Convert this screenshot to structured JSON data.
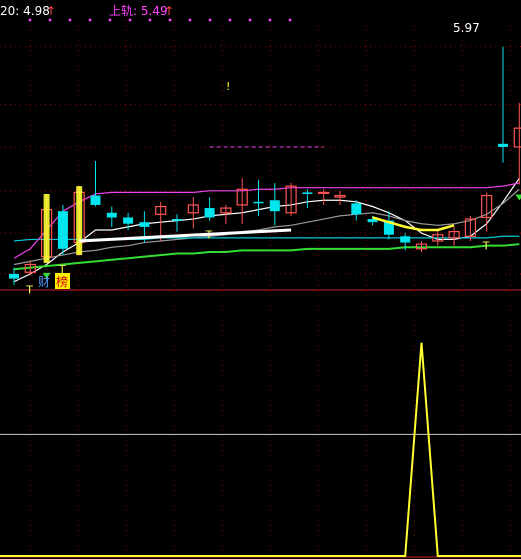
{
  "header": {
    "ma_label": "20: 4.98",
    "ma_arrow": "↑",
    "upper_label": "上轨: 5.49",
    "upper_arrow": "↑"
  },
  "annotations": {
    "high_price": "5.97",
    "t_marker": "T",
    "excl_marker": "!",
    "tag_cai": "财",
    "tag_bang": "榜"
  },
  "colors": {
    "up": "#ff5555",
    "down": "#00e5ee",
    "ma_white": "#ffffff",
    "ma_gray": "#999999",
    "mid_cyan": "#00c8d8",
    "lower_green": "#33dd33",
    "upper_magenta": "#ee44ee",
    "signal_yellow": "#ffff33",
    "ma_label": "#ffffff",
    "upper_label": "#ff44ff",
    "grid": "#880000"
  },
  "chart_data": [
    {
      "type": "candlestick",
      "price_range": [
        4.43,
        6.14
      ],
      "candles": [
        {
          "open": 4.52,
          "high": 4.56,
          "low": 4.45,
          "close": 4.49
        },
        {
          "open": 4.53,
          "high": 4.6,
          "low": 4.51,
          "close": 4.58
        },
        {
          "open": 4.63,
          "high": 5.03,
          "low": 4.59,
          "close": 4.93
        },
        {
          "open": 4.92,
          "high": 4.96,
          "low": 4.64,
          "close": 4.68
        },
        {
          "open": 4.72,
          "high": 5.08,
          "low": 4.64,
          "close": 5.04
        },
        {
          "open": 5.02,
          "high": 5.24,
          "low": 4.95,
          "close": 4.96
        },
        {
          "open": 4.91,
          "high": 4.95,
          "low": 4.82,
          "close": 4.88
        },
        {
          "open": 4.88,
          "high": 4.91,
          "low": 4.8,
          "close": 4.84
        },
        {
          "open": 4.85,
          "high": 4.92,
          "low": 4.72,
          "close": 4.82
        },
        {
          "open": 4.9,
          "high": 4.98,
          "low": 4.73,
          "close": 4.95
        },
        {
          "open": 4.87,
          "high": 4.9,
          "low": 4.79,
          "close": 4.86
        },
        {
          "open": 4.91,
          "high": 5.01,
          "low": 4.81,
          "close": 4.96
        },
        {
          "open": 4.94,
          "high": 5.01,
          "low": 4.86,
          "close": 4.88
        },
        {
          "open": 4.91,
          "high": 4.96,
          "low": 4.84,
          "close": 4.94
        },
        {
          "open": 4.96,
          "high": 5.13,
          "low": 4.84,
          "close": 5.06
        },
        {
          "open": 4.98,
          "high": 5.12,
          "low": 4.89,
          "close": 4.97
        },
        {
          "open": 4.99,
          "high": 5.1,
          "low": 4.83,
          "close": 4.92
        },
        {
          "open": 4.91,
          "high": 5.1,
          "low": 4.89,
          "close": 5.08
        },
        {
          "open": 5.04,
          "high": 5.06,
          "low": 4.94,
          "close": 5.03
        },
        {
          "open": 5.04,
          "high": 5.06,
          "low": 4.96,
          "close": 5.04
        },
        {
          "open": 5.01,
          "high": 5.05,
          "low": 4.96,
          "close": 5.02
        },
        {
          "open": 4.97,
          "high": 4.99,
          "low": 4.86,
          "close": 4.9
        },
        {
          "open": 4.87,
          "high": 4.89,
          "low": 4.83,
          "close": 4.85
        },
        {
          "open": 4.86,
          "high": 4.92,
          "low": 4.74,
          "close": 4.77
        },
        {
          "open": 4.76,
          "high": 4.78,
          "low": 4.67,
          "close": 4.72
        },
        {
          "open": 4.68,
          "high": 4.73,
          "low": 4.66,
          "close": 4.71
        },
        {
          "open": 4.73,
          "high": 4.81,
          "low": 4.7,
          "close": 4.77
        },
        {
          "open": 4.75,
          "high": 4.82,
          "low": 4.7,
          "close": 4.79
        },
        {
          "open": 4.76,
          "high": 4.89,
          "low": 4.73,
          "close": 4.87
        },
        {
          "open": 4.88,
          "high": 5.04,
          "low": 4.79,
          "close": 5.02
        },
        {
          "open": 5.35,
          "high": 5.97,
          "low": 5.23,
          "close": 5.33
        },
        {
          "open": 5.33,
          "high": 5.61,
          "low": 5.09,
          "close": 5.45
        }
      ],
      "series": [
        {
          "name": "",
          "color_key": "ma_white",
          "values": [
            4.47,
            4.52,
            4.58,
            4.66,
            4.72,
            4.8,
            4.8,
            4.82,
            4.84,
            4.85,
            4.86,
            4.87,
            4.89,
            4.9,
            4.91,
            4.93,
            4.95,
            4.96,
            4.98,
            4.99,
            4.99,
            4.98,
            4.95,
            4.91,
            4.86,
            4.78,
            4.74,
            4.74,
            4.76,
            4.84,
            4.98,
            5.13
          ]
        },
        {
          "name": "",
          "color_key": "ma_gray",
          "values": [
            4.58,
            4.6,
            4.62,
            4.64,
            4.66,
            4.67,
            4.69,
            4.7,
            4.72,
            4.73,
            4.74,
            4.75,
            4.76,
            4.77,
            4.79,
            4.8,
            4.82,
            4.83,
            4.85,
            4.87,
            4.89,
            4.9,
            4.91,
            4.89,
            4.86,
            4.84,
            4.83,
            4.84,
            4.86,
            4.9,
            4.97,
            5.06
          ]
        },
        {
          "name": "",
          "color_key": "mid_cyan",
          "values": [
            4.73,
            4.74,
            4.74,
            4.74,
            4.74,
            4.74,
            4.74,
            4.74,
            4.74,
            4.75,
            4.75,
            4.75,
            4.75,
            4.75,
            4.75,
            4.75,
            4.75,
            4.75,
            4.75,
            4.75,
            4.75,
            4.75,
            4.75,
            4.75,
            4.75,
            4.75,
            4.75,
            4.75,
            4.75,
            4.75,
            4.76,
            4.76
          ]
        },
        {
          "name": "",
          "color_key": "lower_green",
          "values": [
            4.55,
            4.56,
            4.57,
            4.58,
            4.59,
            4.6,
            4.61,
            4.62,
            4.63,
            4.64,
            4.65,
            4.65,
            4.66,
            4.66,
            4.67,
            4.67,
            4.67,
            4.67,
            4.68,
            4.68,
            4.68,
            4.68,
            4.68,
            4.68,
            4.69,
            4.69,
            4.69,
            4.69,
            4.69,
            4.7,
            4.7,
            4.71
          ]
        },
        {
          "name": "",
          "color_key": "upper_magenta",
          "values": [
            4.62,
            4.68,
            4.8,
            4.92,
            4.98,
            5.03,
            5.04,
            5.04,
            5.04,
            5.04,
            5.04,
            5.04,
            5.05,
            5.05,
            5.05,
            5.06,
            5.06,
            5.07,
            5.07,
            5.07,
            5.07,
            5.07,
            5.07,
            5.07,
            5.07,
            5.07,
            5.07,
            5.07,
            5.07,
            5.07,
            5.08,
            5.1
          ]
        }
      ]
    },
    {
      "type": "line",
      "y_range": [
        0,
        1.2
      ],
      "reference_line": 0.57,
      "values": [
        0,
        0,
        0,
        0,
        0,
        0,
        0,
        0,
        0,
        0,
        0,
        0,
        0,
        0,
        0,
        0,
        0,
        0,
        0,
        0,
        0,
        0,
        0,
        0,
        0,
        1,
        0,
        0,
        0,
        0,
        0,
        0
      ]
    }
  ]
}
